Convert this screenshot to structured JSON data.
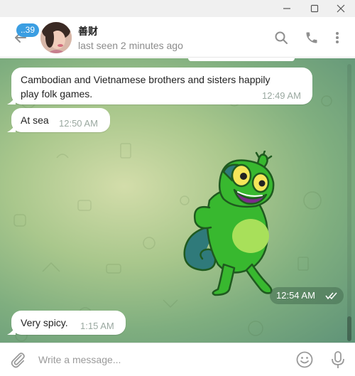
{
  "window": {
    "controls": {
      "minimize_icon": "minimize-icon",
      "maximize_icon": "maximize-icon",
      "close_icon": "close-icon"
    }
  },
  "header": {
    "unread_badge": "..39",
    "contact_name": "善财",
    "status": "last seen 2 minutes ago",
    "icons": [
      "back-arrow-icon",
      "search-icon",
      "phone-icon",
      "more-vertical-icon"
    ]
  },
  "messages": [
    {
      "text_line1": "Cambodian and Vietnamese brothers and sisters happily",
      "text_line2": "play folk games.",
      "time": "12:49 AM"
    },
    {
      "text": "At sea",
      "time": "12:50 AM"
    },
    {
      "type": "sticker",
      "description_icon": "chameleon-sticker",
      "time": "12:54 AM",
      "read_icon": "double-check-icon"
    },
    {
      "text": "Very spicy.",
      "time": "1:15 AM"
    }
  ],
  "composer": {
    "placeholder": "Write a message...",
    "icons": [
      "paperclip-icon",
      "emoji-icon",
      "microphone-icon"
    ]
  },
  "colors": {
    "accent": "#3b9ee2",
    "bubble": "#ffffff",
    "wallpaper_light": "#d3ddaa",
    "wallpaper_dark": "#5f9378"
  }
}
